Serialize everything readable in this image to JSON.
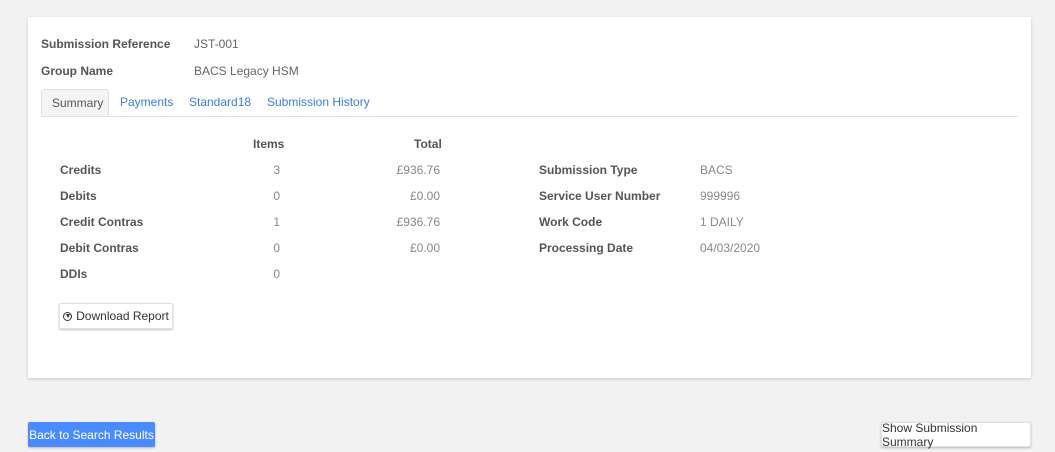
{
  "meta": {
    "submission_reference_label": "Submission Reference",
    "submission_reference_value": "JST-001",
    "group_name_label": "Group Name",
    "group_name_value": "BACS Legacy HSM"
  },
  "tabs": [
    {
      "label": "Summary",
      "active": true
    },
    {
      "label": "Payments",
      "active": false
    },
    {
      "label": "Standard18",
      "active": false
    },
    {
      "label": "Submission History",
      "active": false
    }
  ],
  "summary_table": {
    "headers": {
      "items": "Items",
      "total": "Total"
    },
    "rows": [
      {
        "label": "Credits",
        "items": "3",
        "total": "£936.76"
      },
      {
        "label": "Debits",
        "items": "0",
        "total": "£0.00"
      },
      {
        "label": "Credit Contras",
        "items": "1",
        "total": "£936.76"
      },
      {
        "label": "Debit Contras",
        "items": "0",
        "total": "£0.00"
      },
      {
        "label": "DDIs",
        "items": "0",
        "total": ""
      }
    ]
  },
  "details": [
    {
      "label": "Submission Type",
      "value": "BACS"
    },
    {
      "label": "Service User Number",
      "value": "999996"
    },
    {
      "label": "Work Code",
      "value": "1 DAILY"
    },
    {
      "label": "Processing Date",
      "value": "04/03/2020"
    }
  ],
  "buttons": {
    "download_report": "Download Report",
    "download_icon": "circle-arrow-down-icon",
    "back_to_search": "Back to Search Results",
    "show_submission_summary": "Show Submission Summary"
  },
  "colors": {
    "primary": "#4a8cff",
    "link": "#3b7ddd",
    "background": "#f2f2f2"
  }
}
